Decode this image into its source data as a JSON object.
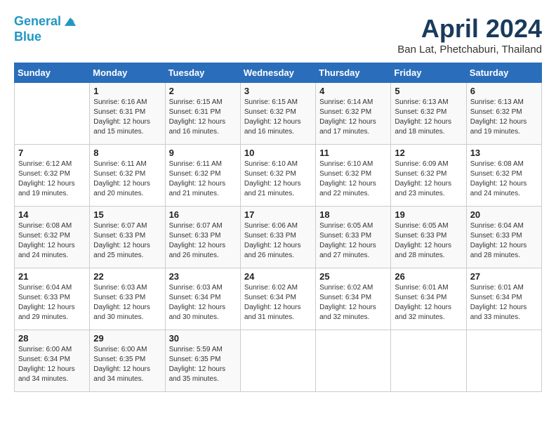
{
  "logo": {
    "line1": "General",
    "line2": "Blue"
  },
  "title": "April 2024",
  "subtitle": "Ban Lat, Phetchaburi, Thailand",
  "days_of_week": [
    "Sunday",
    "Monday",
    "Tuesday",
    "Wednesday",
    "Thursday",
    "Friday",
    "Saturday"
  ],
  "weeks": [
    [
      {
        "day": "",
        "sunrise": "",
        "sunset": "",
        "daylight": ""
      },
      {
        "day": "1",
        "sunrise": "Sunrise: 6:16 AM",
        "sunset": "Sunset: 6:31 PM",
        "daylight": "Daylight: 12 hours and 15 minutes."
      },
      {
        "day": "2",
        "sunrise": "Sunrise: 6:15 AM",
        "sunset": "Sunset: 6:31 PM",
        "daylight": "Daylight: 12 hours and 16 minutes."
      },
      {
        "day": "3",
        "sunrise": "Sunrise: 6:15 AM",
        "sunset": "Sunset: 6:32 PM",
        "daylight": "Daylight: 12 hours and 16 minutes."
      },
      {
        "day": "4",
        "sunrise": "Sunrise: 6:14 AM",
        "sunset": "Sunset: 6:32 PM",
        "daylight": "Daylight: 12 hours and 17 minutes."
      },
      {
        "day": "5",
        "sunrise": "Sunrise: 6:13 AM",
        "sunset": "Sunset: 6:32 PM",
        "daylight": "Daylight: 12 hours and 18 minutes."
      },
      {
        "day": "6",
        "sunrise": "Sunrise: 6:13 AM",
        "sunset": "Sunset: 6:32 PM",
        "daylight": "Daylight: 12 hours and 19 minutes."
      }
    ],
    [
      {
        "day": "7",
        "sunrise": "Sunrise: 6:12 AM",
        "sunset": "Sunset: 6:32 PM",
        "daylight": "Daylight: 12 hours and 19 minutes."
      },
      {
        "day": "8",
        "sunrise": "Sunrise: 6:11 AM",
        "sunset": "Sunset: 6:32 PM",
        "daylight": "Daylight: 12 hours and 20 minutes."
      },
      {
        "day": "9",
        "sunrise": "Sunrise: 6:11 AM",
        "sunset": "Sunset: 6:32 PM",
        "daylight": "Daylight: 12 hours and 21 minutes."
      },
      {
        "day": "10",
        "sunrise": "Sunrise: 6:10 AM",
        "sunset": "Sunset: 6:32 PM",
        "daylight": "Daylight: 12 hours and 21 minutes."
      },
      {
        "day": "11",
        "sunrise": "Sunrise: 6:10 AM",
        "sunset": "Sunset: 6:32 PM",
        "daylight": "Daylight: 12 hours and 22 minutes."
      },
      {
        "day": "12",
        "sunrise": "Sunrise: 6:09 AM",
        "sunset": "Sunset: 6:32 PM",
        "daylight": "Daylight: 12 hours and 23 minutes."
      },
      {
        "day": "13",
        "sunrise": "Sunrise: 6:08 AM",
        "sunset": "Sunset: 6:32 PM",
        "daylight": "Daylight: 12 hours and 24 minutes."
      }
    ],
    [
      {
        "day": "14",
        "sunrise": "Sunrise: 6:08 AM",
        "sunset": "Sunset: 6:32 PM",
        "daylight": "Daylight: 12 hours and 24 minutes."
      },
      {
        "day": "15",
        "sunrise": "Sunrise: 6:07 AM",
        "sunset": "Sunset: 6:33 PM",
        "daylight": "Daylight: 12 hours and 25 minutes."
      },
      {
        "day": "16",
        "sunrise": "Sunrise: 6:07 AM",
        "sunset": "Sunset: 6:33 PM",
        "daylight": "Daylight: 12 hours and 26 minutes."
      },
      {
        "day": "17",
        "sunrise": "Sunrise: 6:06 AM",
        "sunset": "Sunset: 6:33 PM",
        "daylight": "Daylight: 12 hours and 26 minutes."
      },
      {
        "day": "18",
        "sunrise": "Sunrise: 6:05 AM",
        "sunset": "Sunset: 6:33 PM",
        "daylight": "Daylight: 12 hours and 27 minutes."
      },
      {
        "day": "19",
        "sunrise": "Sunrise: 6:05 AM",
        "sunset": "Sunset: 6:33 PM",
        "daylight": "Daylight: 12 hours and 28 minutes."
      },
      {
        "day": "20",
        "sunrise": "Sunrise: 6:04 AM",
        "sunset": "Sunset: 6:33 PM",
        "daylight": "Daylight: 12 hours and 28 minutes."
      }
    ],
    [
      {
        "day": "21",
        "sunrise": "Sunrise: 6:04 AM",
        "sunset": "Sunset: 6:33 PM",
        "daylight": "Daylight: 12 hours and 29 minutes."
      },
      {
        "day": "22",
        "sunrise": "Sunrise: 6:03 AM",
        "sunset": "Sunset: 6:33 PM",
        "daylight": "Daylight: 12 hours and 30 minutes."
      },
      {
        "day": "23",
        "sunrise": "Sunrise: 6:03 AM",
        "sunset": "Sunset: 6:34 PM",
        "daylight": "Daylight: 12 hours and 30 minutes."
      },
      {
        "day": "24",
        "sunrise": "Sunrise: 6:02 AM",
        "sunset": "Sunset: 6:34 PM",
        "daylight": "Daylight: 12 hours and 31 minutes."
      },
      {
        "day": "25",
        "sunrise": "Sunrise: 6:02 AM",
        "sunset": "Sunset: 6:34 PM",
        "daylight": "Daylight: 12 hours and 32 minutes."
      },
      {
        "day": "26",
        "sunrise": "Sunrise: 6:01 AM",
        "sunset": "Sunset: 6:34 PM",
        "daylight": "Daylight: 12 hours and 32 minutes."
      },
      {
        "day": "27",
        "sunrise": "Sunrise: 6:01 AM",
        "sunset": "Sunset: 6:34 PM",
        "daylight": "Daylight: 12 hours and 33 minutes."
      }
    ],
    [
      {
        "day": "28",
        "sunrise": "Sunrise: 6:00 AM",
        "sunset": "Sunset: 6:34 PM",
        "daylight": "Daylight: 12 hours and 34 minutes."
      },
      {
        "day": "29",
        "sunrise": "Sunrise: 6:00 AM",
        "sunset": "Sunset: 6:35 PM",
        "daylight": "Daylight: 12 hours and 34 minutes."
      },
      {
        "day": "30",
        "sunrise": "Sunrise: 5:59 AM",
        "sunset": "Sunset: 6:35 PM",
        "daylight": "Daylight: 12 hours and 35 minutes."
      },
      {
        "day": "",
        "sunrise": "",
        "sunset": "",
        "daylight": ""
      },
      {
        "day": "",
        "sunrise": "",
        "sunset": "",
        "daylight": ""
      },
      {
        "day": "",
        "sunrise": "",
        "sunset": "",
        "daylight": ""
      },
      {
        "day": "",
        "sunrise": "",
        "sunset": "",
        "daylight": ""
      }
    ]
  ]
}
